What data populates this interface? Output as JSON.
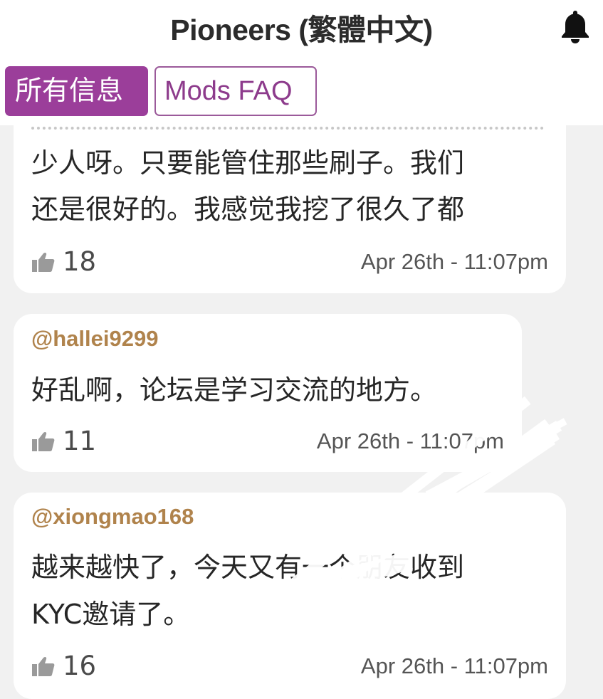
{
  "header": {
    "title": "Pioneers (繁體中文)",
    "tabs": [
      {
        "label": "所有信息",
        "active": true
      },
      {
        "label": "Mods FAQ",
        "active": false
      }
    ]
  },
  "colors": {
    "accent": "#9b3e9a",
    "author": "#b0834c",
    "card": "#ffffff",
    "background": "#f1f1f1"
  },
  "icons": {
    "notification": "bell-icon",
    "like": "thumbs-up-icon"
  },
  "posts": [
    {
      "author": "",
      "lines": [
        "少人呀。只要能管住那些刷子。我们",
        "还是很好的。我感觉我挖了很久了都"
      ],
      "likes": "18",
      "time": "Apr 26th - 11:07pm"
    },
    {
      "author": "@hallei9299",
      "lines": [
        "好乱啊，论坛是学习交流的地方。"
      ],
      "likes": "11",
      "time": "Apr 26th - 11:07pm"
    },
    {
      "author": "@xiongmao168",
      "lines": [
        "越来越快了，今天又有一个朋友收到",
        "KYC邀请了。"
      ],
      "likes": "16",
      "time": "Apr 26th - 11:07pm"
    }
  ]
}
